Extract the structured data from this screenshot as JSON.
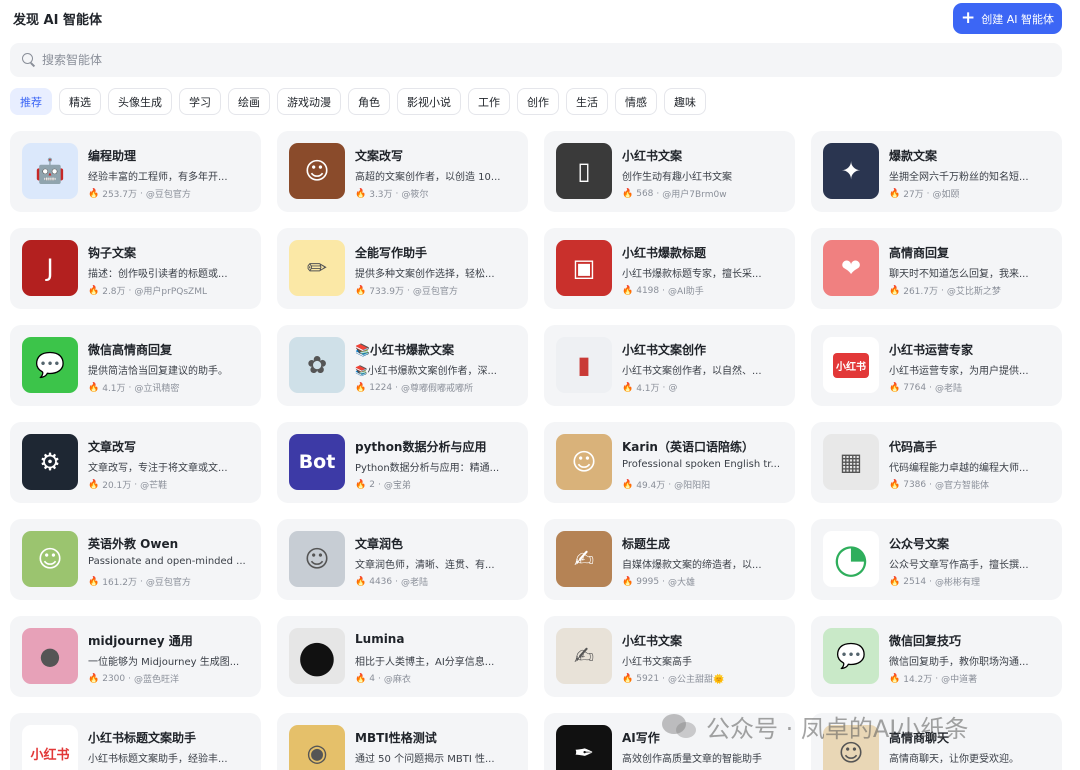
{
  "header": {
    "title": "发现 AI 智能体",
    "create_label": "创建 AI 智能体"
  },
  "search": {
    "placeholder": "搜索智能体"
  },
  "tabs": [
    "推荐",
    "精选",
    "头像生成",
    "学习",
    "绘画",
    "游戏动漫",
    "角色",
    "影视小说",
    "工作",
    "创作",
    "生活",
    "情感",
    "趣味"
  ],
  "agents": [
    {
      "name": "编程助理",
      "desc": "经验丰富的工程师，有多年开...",
      "count": "253.7万",
      "author": "@豆包官方",
      "icon": "robot-icon",
      "color": "#dbe8fb"
    },
    {
      "name": "文案改写",
      "desc": "高超的文案创作者，以创造 10...",
      "count": "3.3万",
      "author": "@筱尔",
      "icon": "boy-avatar-icon",
      "color": "#8a4b2b"
    },
    {
      "name": "小红书文案",
      "desc": "创作生动有趣小红书文案",
      "count": "568",
      "author": "@用户7Brm0w",
      "icon": "phone-icon",
      "color": "#3a3a3a"
    },
    {
      "name": "爆款文案",
      "desc": "坐拥全网六千万粉丝的知名短...",
      "count": "27万",
      "author": "@如颐",
      "icon": "bird-icon",
      "color": "#2a3550"
    },
    {
      "name": "钩子文案",
      "desc": "描述：创作吸引读者的标题或...",
      "count": "2.8万",
      "author": "@用户prPQsZML",
      "icon": "hook-icon",
      "color": "#b3201f"
    },
    {
      "name": "全能写作助手",
      "desc": "提供多种文案创作选择，轻松...",
      "count": "733.9万",
      "author": "@豆包官方",
      "icon": "pencil-icon",
      "color": "#fbe8a6"
    },
    {
      "name": "小红书爆款标题",
      "desc": "小红书爆款标题专家，擅长采...",
      "count": "4198",
      "author": "@AI助手",
      "icon": "red-seal-icon",
      "color": "#c9302c"
    },
    {
      "name": "高情商回复",
      "desc": "聊天时不知道怎么回复，我来...",
      "count": "261.7万",
      "author": "@艾比斯之梦",
      "icon": "heart-letter-icon",
      "color": "#f08080"
    },
    {
      "name": "微信高情商回复",
      "desc": "提供简洁恰当回复建议的助手。",
      "count": "4.1万",
      "author": "@立讯精密",
      "icon": "wechat-icon",
      "color": "#3cc44a"
    },
    {
      "name": "📚小红书爆款文案",
      "desc": "📚小红书爆款文案创作者，深...",
      "count": "1224",
      "author": "@尊嘟假嘟戒嘟所",
      "icon": "illustration-icon",
      "color": "#cfe0e8"
    },
    {
      "name": "小红书文案创作",
      "desc": "小红书文案创作者，以自然、...",
      "count": "4.1万",
      "author": "@",
      "icon": "book-icon",
      "color": "#eef0f3"
    },
    {
      "name": "小红书运营专家",
      "desc": "小红书运营专家，为用户提供...",
      "count": "7764",
      "author": "@老陆",
      "icon": "xhs-logo-icon",
      "color": "#ffffff"
    },
    {
      "name": "文章改写",
      "desc": "文章改写，专注于将文章或文...",
      "count": "20.1万",
      "author": "@芒鞋",
      "icon": "robot-book-icon",
      "color": "#1e2733"
    },
    {
      "name": "python数据分析与应用",
      "desc": "Python数据分析与应用：精通...",
      "count": "2",
      "author": "@宝弟",
      "icon": "bot-text-icon",
      "color": "#3d3aa6"
    },
    {
      "name": "Karin（英语口语陪练）",
      "desc": "Professional spoken English tr...",
      "count": "49.4万",
      "author": "@阳阳阳",
      "icon": "woman-avatar-icon",
      "color": "#d9b27a"
    },
    {
      "name": "代码高手",
      "desc": "代码编程能力卓越的编程大师...",
      "count": "7386",
      "author": "@官方智能体",
      "icon": "maze-icon",
      "color": "#e8e8e8"
    },
    {
      "name": "英语外教 Owen",
      "desc": "Passionate and open-minded ...",
      "count": "161.2万",
      "author": "@豆包官方",
      "icon": "anime-boy-icon",
      "color": "#9bc46f"
    },
    {
      "name": "文章润色",
      "desc": "文章润色师，清晰、连贯、有...",
      "count": "4436",
      "author": "@老陆",
      "icon": "girl-avatar-icon",
      "color": "#c7cdd4"
    },
    {
      "name": "标题生成",
      "desc": "自媒体爆款文案的缔造者，以...",
      "count": "9995",
      "author": "@大雄",
      "icon": "writing-hand-icon",
      "color": "#b58355"
    },
    {
      "name": "公众号文案",
      "desc": "公众号文章写作高手，擅长撰...",
      "count": "2514",
      "author": "@彬彬有理",
      "icon": "swirl-logo-icon",
      "color": "#ffffff"
    },
    {
      "name": "midjourney 通用",
      "desc": "一位能够为 Midjourney 生成图...",
      "count": "2300",
      "author": "@蓝色旺洋",
      "icon": "monster-icon",
      "color": "#e7a1b8"
    },
    {
      "name": "Lumina",
      "desc": "相比于人类博主，AI分享信息...",
      "count": "4",
      "author": "@麻衣",
      "icon": "black-orb-icon",
      "color": "#e6e6e6"
    },
    {
      "name": "小红书文案",
      "desc": "小红书文案高手",
      "count": "5921",
      "author": "@公主甜甜🌞",
      "icon": "notebook-hand-icon",
      "color": "#e8e2d8"
    },
    {
      "name": "微信回复技巧",
      "desc": "微信回复助手，教你职场沟通...",
      "count": "14.2万",
      "author": "@中道著",
      "icon": "wechat-app-icon",
      "color": "#c9e9c8"
    },
    {
      "name": "小红书标题文案助手",
      "desc": "小红书标题文案助手，经验丰...",
      "count": "",
      "author": "",
      "icon": "xhs-text-icon",
      "color": "#ffffff"
    },
    {
      "name": "MBTI性格测试",
      "desc": "通过 50 个问题揭示 MBTI 性...",
      "count": "",
      "author": "",
      "icon": "gradient-orb-icon",
      "color": "#e5c06a"
    },
    {
      "name": "AI写作",
      "desc": "高效创作高质量文章的智能助手",
      "count": "",
      "author": "",
      "icon": "fountain-pen-icon",
      "color": "#111111"
    },
    {
      "name": "高情商聊天",
      "desc": "高情商聊天，让你更受欢迎。",
      "count": "",
      "author": "",
      "icon": "cute-girl-icon",
      "color": "#e9d7b6"
    }
  ],
  "watermark": {
    "text": "公众号 · 凤卓的AI小纸条"
  }
}
